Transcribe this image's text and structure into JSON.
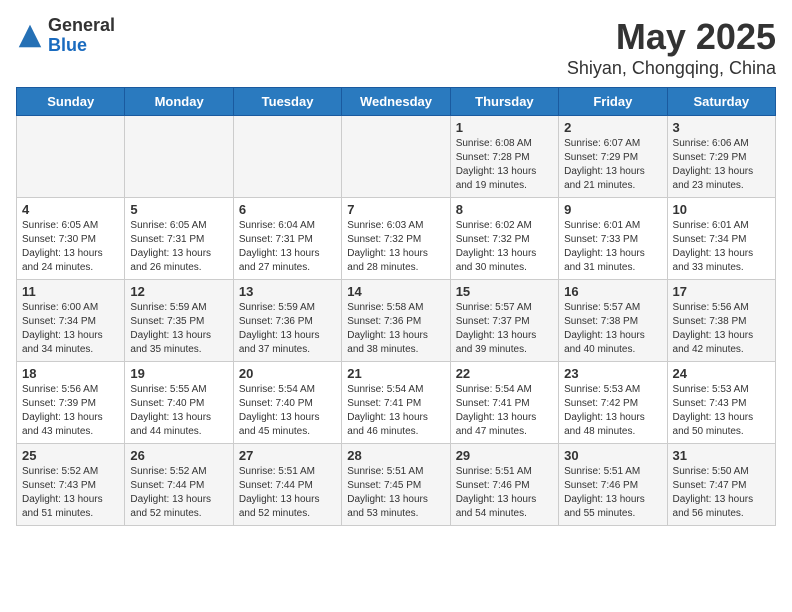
{
  "header": {
    "logo_general": "General",
    "logo_blue": "Blue",
    "month_year": "May 2025",
    "location": "Shiyan, Chongqing, China"
  },
  "weekdays": [
    "Sunday",
    "Monday",
    "Tuesday",
    "Wednesday",
    "Thursday",
    "Friday",
    "Saturday"
  ],
  "weeks": [
    [
      {
        "day": "",
        "info": ""
      },
      {
        "day": "",
        "info": ""
      },
      {
        "day": "",
        "info": ""
      },
      {
        "day": "",
        "info": ""
      },
      {
        "day": "1",
        "info": "Sunrise: 6:08 AM\nSunset: 7:28 PM\nDaylight: 13 hours\nand 19 minutes."
      },
      {
        "day": "2",
        "info": "Sunrise: 6:07 AM\nSunset: 7:29 PM\nDaylight: 13 hours\nand 21 minutes."
      },
      {
        "day": "3",
        "info": "Sunrise: 6:06 AM\nSunset: 7:29 PM\nDaylight: 13 hours\nand 23 minutes."
      }
    ],
    [
      {
        "day": "4",
        "info": "Sunrise: 6:05 AM\nSunset: 7:30 PM\nDaylight: 13 hours\nand 24 minutes."
      },
      {
        "day": "5",
        "info": "Sunrise: 6:05 AM\nSunset: 7:31 PM\nDaylight: 13 hours\nand 26 minutes."
      },
      {
        "day": "6",
        "info": "Sunrise: 6:04 AM\nSunset: 7:31 PM\nDaylight: 13 hours\nand 27 minutes."
      },
      {
        "day": "7",
        "info": "Sunrise: 6:03 AM\nSunset: 7:32 PM\nDaylight: 13 hours\nand 28 minutes."
      },
      {
        "day": "8",
        "info": "Sunrise: 6:02 AM\nSunset: 7:32 PM\nDaylight: 13 hours\nand 30 minutes."
      },
      {
        "day": "9",
        "info": "Sunrise: 6:01 AM\nSunset: 7:33 PM\nDaylight: 13 hours\nand 31 minutes."
      },
      {
        "day": "10",
        "info": "Sunrise: 6:01 AM\nSunset: 7:34 PM\nDaylight: 13 hours\nand 33 minutes."
      }
    ],
    [
      {
        "day": "11",
        "info": "Sunrise: 6:00 AM\nSunset: 7:34 PM\nDaylight: 13 hours\nand 34 minutes."
      },
      {
        "day": "12",
        "info": "Sunrise: 5:59 AM\nSunset: 7:35 PM\nDaylight: 13 hours\nand 35 minutes."
      },
      {
        "day": "13",
        "info": "Sunrise: 5:59 AM\nSunset: 7:36 PM\nDaylight: 13 hours\nand 37 minutes."
      },
      {
        "day": "14",
        "info": "Sunrise: 5:58 AM\nSunset: 7:36 PM\nDaylight: 13 hours\nand 38 minutes."
      },
      {
        "day": "15",
        "info": "Sunrise: 5:57 AM\nSunset: 7:37 PM\nDaylight: 13 hours\nand 39 minutes."
      },
      {
        "day": "16",
        "info": "Sunrise: 5:57 AM\nSunset: 7:38 PM\nDaylight: 13 hours\nand 40 minutes."
      },
      {
        "day": "17",
        "info": "Sunrise: 5:56 AM\nSunset: 7:38 PM\nDaylight: 13 hours\nand 42 minutes."
      }
    ],
    [
      {
        "day": "18",
        "info": "Sunrise: 5:56 AM\nSunset: 7:39 PM\nDaylight: 13 hours\nand 43 minutes."
      },
      {
        "day": "19",
        "info": "Sunrise: 5:55 AM\nSunset: 7:40 PM\nDaylight: 13 hours\nand 44 minutes."
      },
      {
        "day": "20",
        "info": "Sunrise: 5:54 AM\nSunset: 7:40 PM\nDaylight: 13 hours\nand 45 minutes."
      },
      {
        "day": "21",
        "info": "Sunrise: 5:54 AM\nSunset: 7:41 PM\nDaylight: 13 hours\nand 46 minutes."
      },
      {
        "day": "22",
        "info": "Sunrise: 5:54 AM\nSunset: 7:41 PM\nDaylight: 13 hours\nand 47 minutes."
      },
      {
        "day": "23",
        "info": "Sunrise: 5:53 AM\nSunset: 7:42 PM\nDaylight: 13 hours\nand 48 minutes."
      },
      {
        "day": "24",
        "info": "Sunrise: 5:53 AM\nSunset: 7:43 PM\nDaylight: 13 hours\nand 50 minutes."
      }
    ],
    [
      {
        "day": "25",
        "info": "Sunrise: 5:52 AM\nSunset: 7:43 PM\nDaylight: 13 hours\nand 51 minutes."
      },
      {
        "day": "26",
        "info": "Sunrise: 5:52 AM\nSunset: 7:44 PM\nDaylight: 13 hours\nand 52 minutes."
      },
      {
        "day": "27",
        "info": "Sunrise: 5:51 AM\nSunset: 7:44 PM\nDaylight: 13 hours\nand 52 minutes."
      },
      {
        "day": "28",
        "info": "Sunrise: 5:51 AM\nSunset: 7:45 PM\nDaylight: 13 hours\nand 53 minutes."
      },
      {
        "day": "29",
        "info": "Sunrise: 5:51 AM\nSunset: 7:46 PM\nDaylight: 13 hours\nand 54 minutes."
      },
      {
        "day": "30",
        "info": "Sunrise: 5:51 AM\nSunset: 7:46 PM\nDaylight: 13 hours\nand 55 minutes."
      },
      {
        "day": "31",
        "info": "Sunrise: 5:50 AM\nSunset: 7:47 PM\nDaylight: 13 hours\nand 56 minutes."
      }
    ]
  ]
}
